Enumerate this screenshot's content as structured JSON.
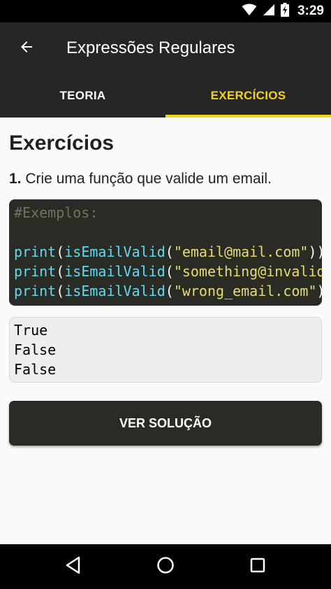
{
  "status_bar": {
    "time": "3:29",
    "icons": [
      "wifi-icon",
      "cell-signal-icon",
      "battery-charging-icon"
    ]
  },
  "app_bar": {
    "title": "Expressões Regulares",
    "back_icon": "arrow-back-icon"
  },
  "tabs": [
    {
      "label": "TEORIA",
      "active": false
    },
    {
      "label": "EXERCÍCIOS",
      "active": true
    }
  ],
  "content": {
    "heading": "Exercícios",
    "question_number": "1.",
    "question_text": " Crie uma função que valide um email.",
    "code_comment": "#Exemplos:",
    "code_lines": [
      {
        "fn": "print",
        "open": "(",
        "call": "isEmailValid",
        "open2": "(",
        "arg": "\"email@mail.com\"",
        "close": "))"
      },
      {
        "fn": "print",
        "open": "(",
        "call": "isEmailValid",
        "open2": "(",
        "arg": "\"something@invalid\"",
        "close": "))"
      },
      {
        "fn": "print",
        "open": "(",
        "call": "isEmailValid",
        "open2": "(",
        "arg": "\"wrong_email.com\"",
        "close": "))"
      }
    ],
    "output_lines": [
      "True",
      "False",
      "False"
    ],
    "solution_button_label": "VER SOLUÇÃO"
  },
  "nav_bar": {
    "buttons": [
      "back-triangle-icon",
      "home-circle-icon",
      "recents-square-icon"
    ]
  },
  "colors": {
    "accent": "#f3d21b",
    "toolbar": "#262626",
    "code_background": "#2b2b25",
    "code_function": "#66d9ef",
    "code_string": "#e6db74",
    "code_comment": "#75715e"
  }
}
